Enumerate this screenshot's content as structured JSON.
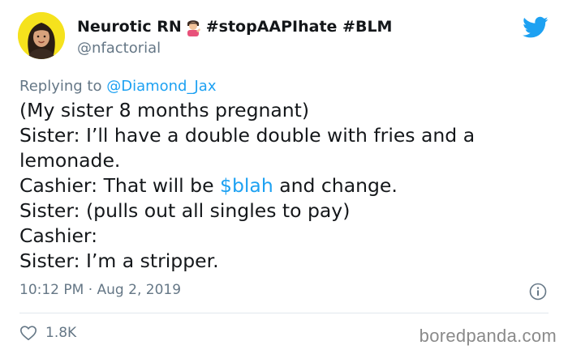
{
  "user": {
    "display_name": "Neurotic RN",
    "hashtags": "#stopAAPIhate #BLM",
    "handle": "@nfactorial"
  },
  "reply": {
    "prefix": "Replying to ",
    "mention": "@Diamond_Jax"
  },
  "body": {
    "line1": "(My sister 8 months pregnant)",
    "line2": "Sister: I’ll have a double double with fries and a",
    "line3": "lemonade.",
    "line4_pre": "Cashier: That will be ",
    "line4_link": "$blah",
    "line4_post": " and change.",
    "line5": "Sister: (pulls out all singles to pay)",
    "line6": "Cashier:",
    "line7": "Sister: I’m a stripper."
  },
  "meta": {
    "timestamp": "10:12 PM · Aug 2, 2019"
  },
  "stats": {
    "likes": "1.8K"
  },
  "watermark": "boredpanda.com",
  "colors": {
    "twitter_blue": "#1da1f2",
    "muted_text": "#657786",
    "avatar_bg": "#f5e21d"
  },
  "icons": {
    "brand": "twitter-bird-icon",
    "info": "info-icon",
    "like": "heart-icon",
    "emoji": "person-tipping-hand-emoji"
  }
}
